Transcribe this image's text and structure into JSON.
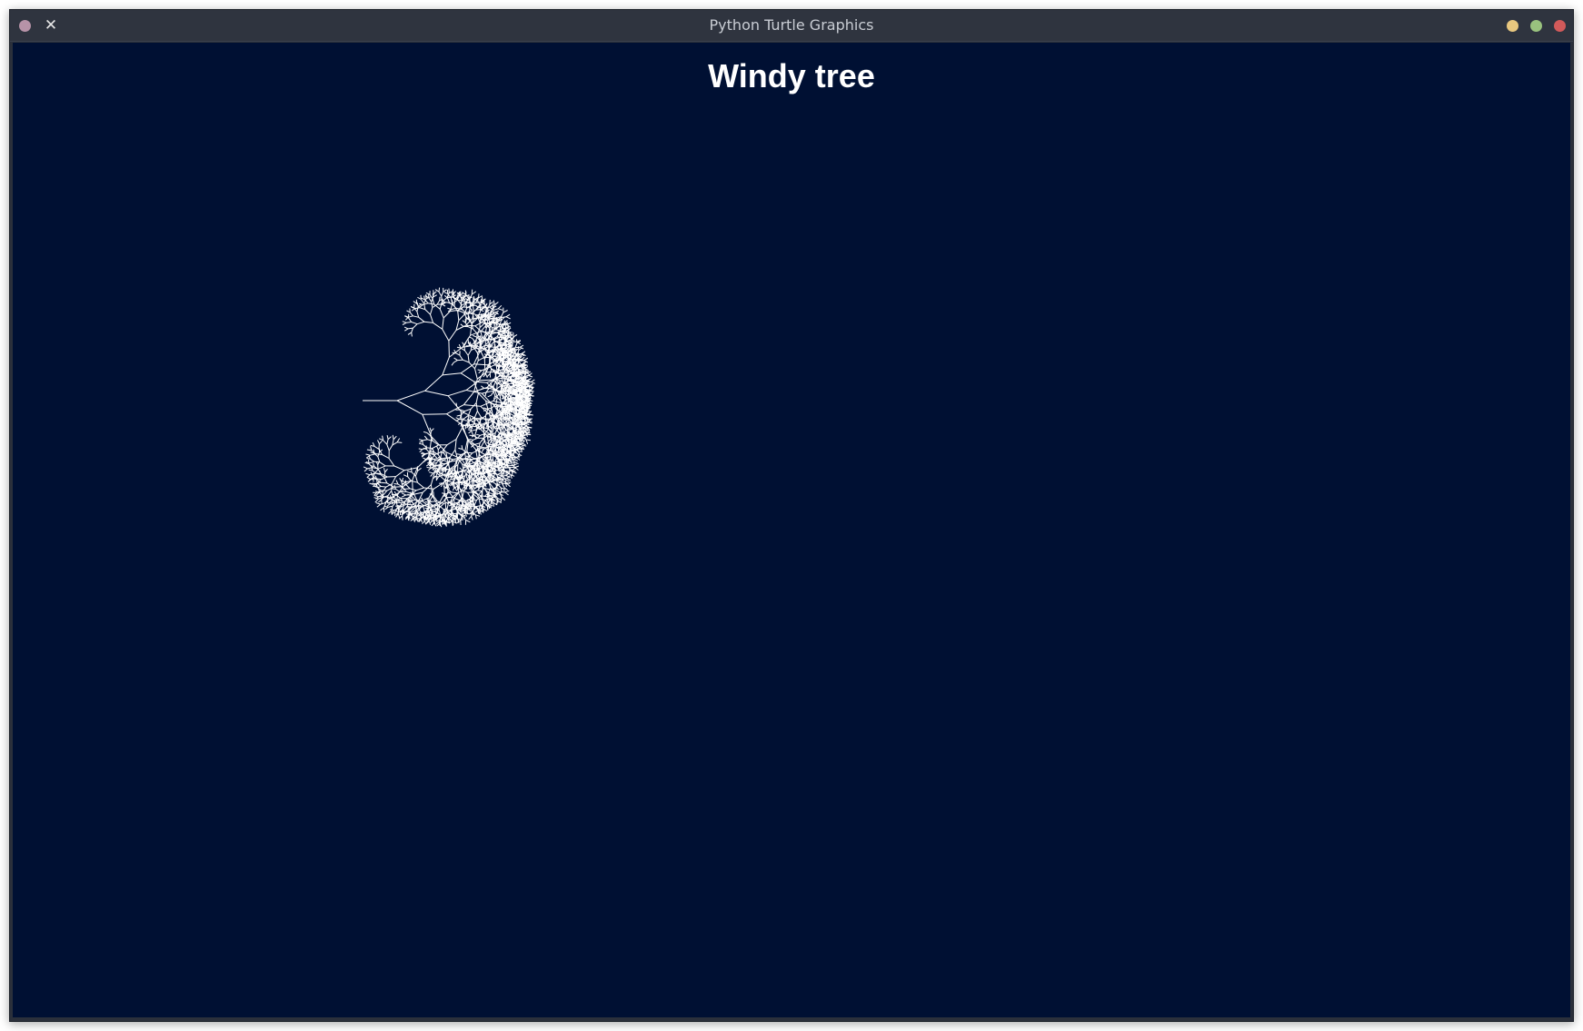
{
  "window": {
    "title": "Python Turtle Graphics",
    "pin_glyph": "✕"
  },
  "canvas": {
    "heading": "Windy tree",
    "background": "#001033",
    "stroke_color": "#ffffff"
  },
  "icons": {
    "menu": "window-menu-icon",
    "pin": "close-x-icon",
    "minimize": "minimize-icon",
    "maximize": "maximize-icon",
    "close": "close-icon"
  }
}
